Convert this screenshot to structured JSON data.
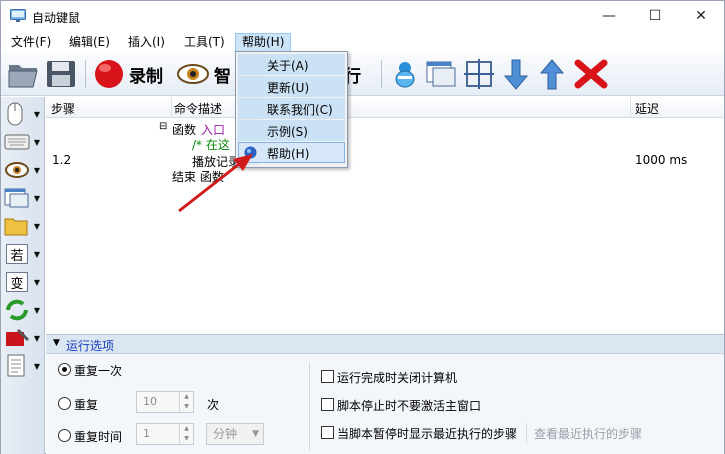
{
  "window": {
    "title": "自动键鼠",
    "controls": {
      "minimize": "—",
      "maximize": "☐",
      "close": "✕"
    }
  },
  "menubar": {
    "items": [
      {
        "label": "文件(F)"
      },
      {
        "label": "编辑(E)"
      },
      {
        "label": "插入(I)"
      },
      {
        "label": "工具(T)"
      },
      {
        "label": "帮助(H)"
      }
    ]
  },
  "help_menu": {
    "items": [
      {
        "label": "关于(A)"
      },
      {
        "label": "更新(U)"
      },
      {
        "label": "联系我们(C)"
      },
      {
        "label": "示例(S)"
      },
      {
        "label": "帮助(H)"
      }
    ]
  },
  "toolbar": {
    "record_label": "录制",
    "smart_label": "智",
    "run_label": "行"
  },
  "sidebar": {
    "if_label": "若",
    "var_label": "变"
  },
  "list": {
    "columns": {
      "step": "步骤",
      "command": "命令描述",
      "delay": "延迟"
    },
    "rows": {
      "func_keyword": "函数",
      "func_name": "入口",
      "comment": "/* 在这",
      "step_number": "1.2",
      "playback": "播放记录",
      "end": "结束 函数",
      "delay": "1000 ms"
    }
  },
  "options": {
    "title": "运行选项",
    "repeat_once": "重复一次",
    "repeat": "重复",
    "repeat_count": "10",
    "times_unit": "次",
    "repeat_time": "重复时间",
    "time_value": "1",
    "time_unit": "分钟",
    "check_shutdown": "运行完成时关闭计算机",
    "check_no_activate": "脚本停止时不要激活主窗口",
    "check_show_recent": "当脚本暂停时显示最近执行的步骤",
    "view_recent_link": "查看最近执行的步骤"
  },
  "colors": {
    "accent_blue": "#1a3fbf",
    "func_name": "#9b1aa3",
    "comment_green": "#0a8a0a",
    "arrow_red": "#d11a1a"
  }
}
